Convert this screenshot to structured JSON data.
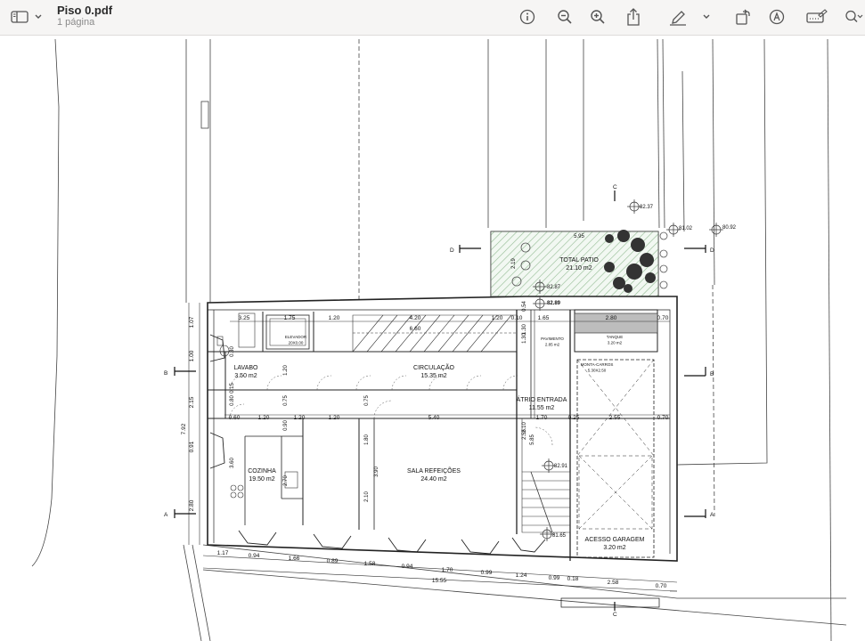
{
  "window": {
    "file_name": "Piso 0.pdf",
    "page_count_label": "1 página"
  },
  "toolbar": {
    "icons": [
      "sidebar-icon",
      "chevron-down-icon",
      "info-icon",
      "zoom-out-icon",
      "zoom-in-icon",
      "share-icon",
      "markup-pen-icon",
      "chevron-down-icon",
      "rotate-icon",
      "annotate-icon",
      "form-fill-icon",
      "search-icon"
    ]
  },
  "plan": {
    "rooms": [
      {
        "name": "LAVABO",
        "area": "3.50 m2"
      },
      {
        "name": "CIRCULAÇÃO",
        "area": "15.35 m2"
      },
      {
        "name": "COZINHA",
        "area": "19.50 m2"
      },
      {
        "name": "SALA REFEIÇÕES",
        "area": "24.40 m2"
      },
      {
        "name": "ÁTRIO ENTRADA",
        "area": "11.55 m2"
      },
      {
        "name": "ACESSO GARAGEM",
        "area": "3.20 m2"
      },
      {
        "name": "TOTAL PATIO",
        "area": "21.10 m2"
      },
      {
        "name": "PAVIMENTO",
        "area": "2.85 m2"
      },
      {
        "name": "TANQUE",
        "area": "3.20 m2"
      },
      {
        "name": "ELEVADOR",
        "area": "20X0.00"
      },
      {
        "name": "MONTA-CARROS",
        "area": "5.30X2.50"
      }
    ],
    "levels": [
      "82.37",
      "81.02",
      "80.92",
      "82.87",
      "82.89",
      "82.91",
      "81.65"
    ],
    "section_marks": [
      "A",
      "A",
      "B",
      "B",
      "C",
      "C",
      "D",
      "D"
    ],
    "dims_top": [
      "3.25",
      "1.75",
      "1.20",
      "4.20",
      "6.60",
      "1.20",
      "0.10",
      "1.65",
      "2.80",
      "0.70"
    ],
    "dims_mid": [
      "0.60",
      "1.20",
      "1.20",
      "1.20",
      "5.40",
      "1.70",
      "0.25",
      "2.55",
      "0.70"
    ],
    "dims_bottom_1": [
      "1.17",
      "0.94",
      "1.66",
      "0.89",
      "1.58",
      "0.94",
      "1.70",
      "0.99",
      "1.24",
      "0.99",
      "0.18",
      "2.58",
      "0.70"
    ],
    "dims_bottom_2": [
      "15.55"
    ],
    "dims_left": [
      "1.07",
      "1.00",
      "2.15",
      "0.91",
      "7.92",
      "2.80"
    ],
    "dims_inner": [
      "1.30",
      "2.19",
      "0.54",
      "1.30",
      "2.10",
      "1.20",
      "0.75",
      "0.75",
      "1.80",
      "3.90",
      "2.10",
      "2.55",
      "5.85",
      "3.60",
      "2.70",
      "0.90",
      "0.15",
      "0.80",
      "0.30",
      "5.95"
    ]
  }
}
